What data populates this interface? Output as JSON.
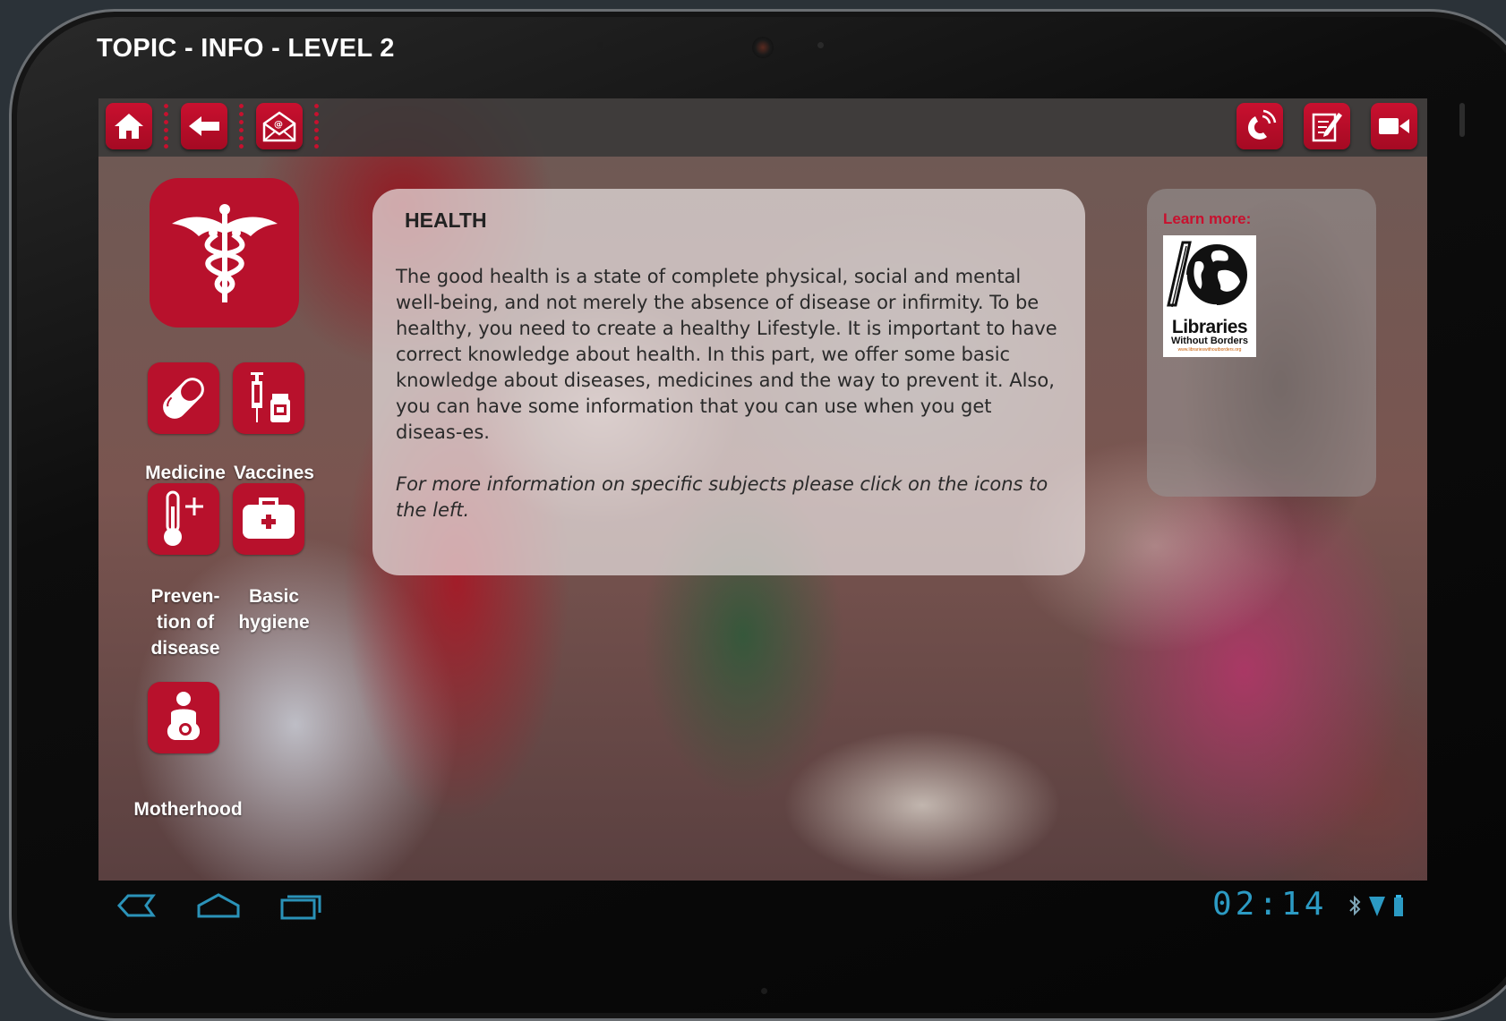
{
  "window": {
    "title": "TOPIC - INFO - LEVEL 2"
  },
  "toolbar": {
    "left_buttons": [
      "home-icon",
      "back-arrow-icon",
      "email-icon"
    ],
    "right_buttons": [
      "phone-icon",
      "edit-note-icon",
      "video-camera-icon"
    ]
  },
  "topic": {
    "main_icon": "caduceus-icon",
    "subtopics": [
      {
        "label": "Medicine",
        "icon": "pill-icon"
      },
      {
        "label": "Vaccines",
        "icon": "syringe-vial-icon"
      },
      {
        "label": "Preven-\ntion of\ndisease",
        "icon": "thermometer-plus-icon"
      },
      {
        "label": "Basic\nhygiene",
        "icon": "first-aid-kit-icon"
      },
      {
        "label": "Motherhood",
        "icon": "mother-child-icon"
      }
    ]
  },
  "info": {
    "title": "HEALTH",
    "body": "The good health is a state of complete physical, social and mental well-being, and not merely the absence of disease or infirmity. To be healthy, you need to create a healthy Lifestyle. It is important to have correct knowledge about health. In this part, we offer some basic knowledge about diseases, medicines and the way to prevent it. Also, you can have some information that you can use when you get diseas-es.",
    "note": "For more information on specific subjects please click on the icons to the left."
  },
  "learn_more": {
    "label": "Learn more:",
    "logo": {
      "name": "Libraries",
      "subtitle": "Without Borders",
      "url": "www.librarieswithoutborders.org"
    }
  },
  "system_bar": {
    "time": "02:14",
    "accent_color": "#33b5e5"
  },
  "colors": {
    "brand_red": "#b8112c",
    "title_white": "#ffffff"
  }
}
